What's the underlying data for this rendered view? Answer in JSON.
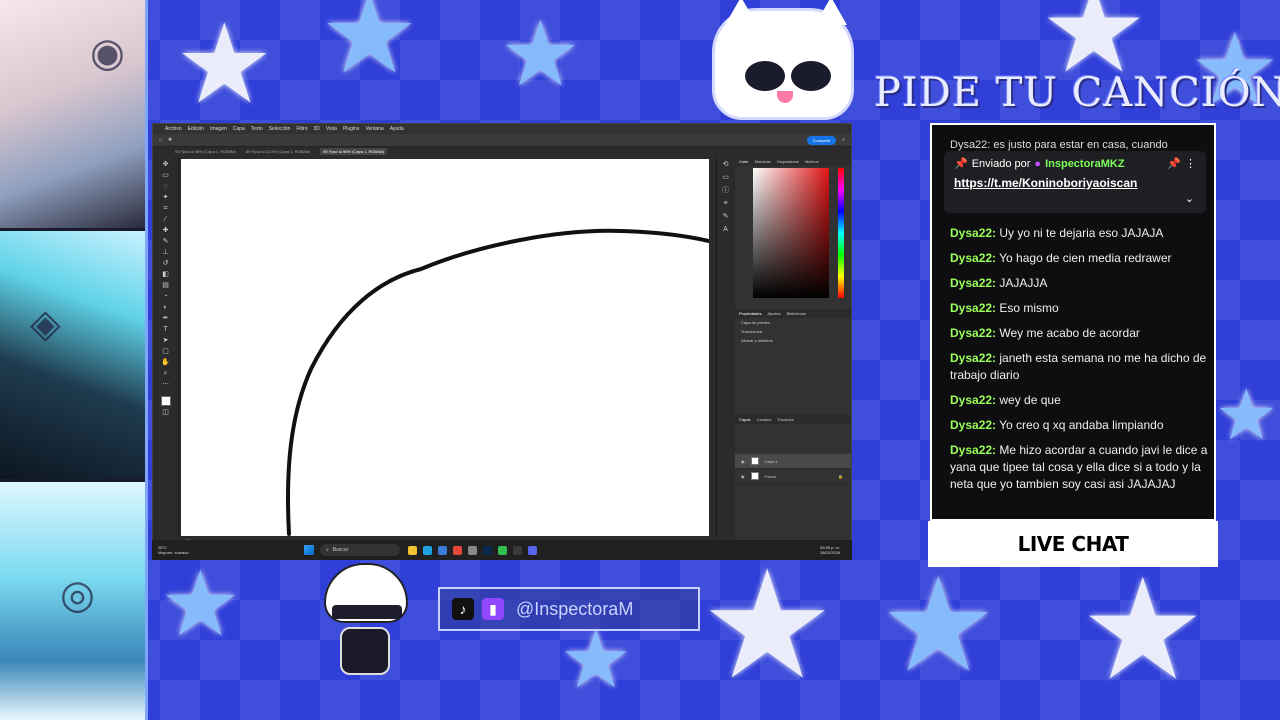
{
  "overlay": {
    "title": "PIDE TU CANCIÓN",
    "live_chat_label": "LIVE CHAT",
    "social_handle": "@InspectoraM",
    "tiktok_icon": "tiktok-icon",
    "twitch_icon": "twitch-icon"
  },
  "photoshop": {
    "menu": [
      "Archivo",
      "Edición",
      "Imagen",
      "Capa",
      "Texto",
      "Selección",
      "Filtro",
      "3D",
      "Vista",
      "Plugins",
      "Ventana",
      "Ayuda"
    ],
    "share_label": "Compartir",
    "tabs": [
      "93 Fpsd al 98% (Capa 1, RGB/8#)",
      "89 Fpsd al 15,5% (Capa 1, RGB/8#)",
      "89 Fpsd al 98% (Capa 1, RGB/8#)"
    ],
    "status_zoom": "98%",
    "panel_tabs": [
      "Color",
      "Muestras",
      "Degradados",
      "Motivos"
    ],
    "props_tabs": [
      "Propiedades",
      "Ajustes",
      "Bibliotecas"
    ],
    "props_rows": [
      "Capa de píxeles",
      "Transformar",
      "Alinear y distribuir"
    ],
    "layers_tabs": [
      "Capas",
      "Canales",
      "Trazados"
    ],
    "layers": [
      {
        "name": "Capa 1",
        "selected": true
      },
      {
        "name": "Fondo",
        "selected": false
      }
    ]
  },
  "taskbar": {
    "weather_temp": "28°C",
    "weather_desc": "Mayorm. soleado",
    "search_placeholder": "Buscar",
    "time": "05:59 p. m.",
    "date": "28/02/2026"
  },
  "chat": {
    "cut_message": "Dysa22: es justo para estar en casa, cuando",
    "pinned_prefix": "Enviado por",
    "pinned_user": "InspectoraMKZ",
    "pinned_link": "https://t.me/Koninoboriyaoiscan",
    "messages": [
      {
        "user": "Dysa22:",
        "text": " Uy yo ni te dejaria eso JAJAJA"
      },
      {
        "user": "Dysa22:",
        "text": " Yo hago de cien media redrawer"
      },
      {
        "user": "Dysa22:",
        "text": " JAJAJJA"
      },
      {
        "user": "Dysa22:",
        "text": " Eso mismo"
      },
      {
        "user": "Dysa22:",
        "text": " Wey me acabo de acordar"
      },
      {
        "user": "Dysa22:",
        "text": " janeth esta semana no me ha dicho de trabajo diario"
      },
      {
        "user": "Dysa22:",
        "text": " wey de que"
      },
      {
        "user": "Dysa22:",
        "text": " Yo creo q xq andaba limpiando"
      },
      {
        "user": "Dysa22:",
        "text": " Me hizo acordar a cuando javi le dice a yana que tipee tal cosa y ella dice si a todo y la neta que yo tambien soy casi asi JAJAJAJ"
      }
    ]
  },
  "colors": {
    "background": "#2f3fd8",
    "chat_username": "#9aff5a",
    "pinned_user": "#7cfc5a"
  }
}
